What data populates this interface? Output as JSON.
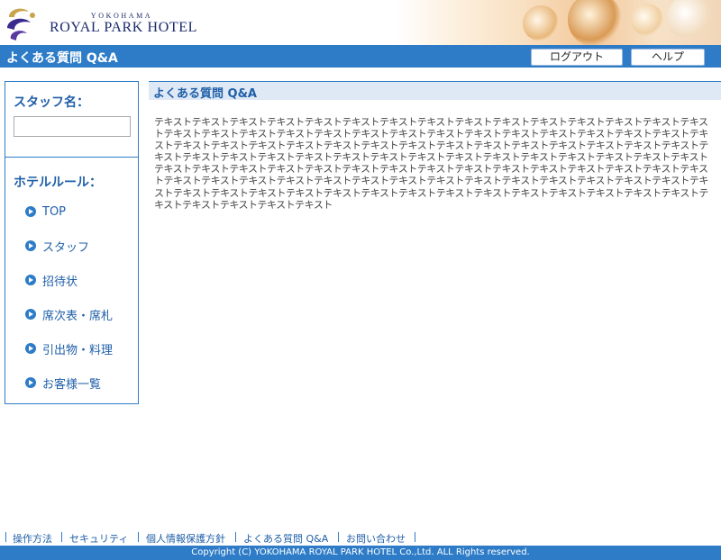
{
  "header": {
    "brand_small": "YOKOHAMA",
    "brand_big": "ROYAL PARK HOTEL"
  },
  "titlebar": {
    "title": "よくある質問 Q&A",
    "logout_label": "ログアウト",
    "help_label": "ヘルプ"
  },
  "sidebar": {
    "staff_label": "スタッフ名：",
    "staff_value": "",
    "rules_label": "ホテルルール：",
    "items": [
      {
        "label": "TOP"
      },
      {
        "label": "スタッフ"
      },
      {
        "label": "招待状"
      },
      {
        "label": "席次表・席札"
      },
      {
        "label": "引出物・料理"
      },
      {
        "label": "お客様一覧"
      }
    ]
  },
  "main": {
    "heading": "よくある質問 Q&A",
    "body": "テキストテキストテキストテキストテキストテキストテキストテキストテキストテキストテキストテキストテキストテキストテキストテキストテキストテキストテキストテキストテキストテキストテキストテキストテキストテキストテキストテキストテキストテキストテキストテキストテキストテキストテキストテキストテキストテキストテキストテキストテキストテキストテキストテキストテキストテキストテキストテキストテキストテキストテキストテキストテキストテキストテキストテキストテキストテキストテキストテキストテキストテキストテキストテキストテキストテキストテキストテキストテキストテキストテキストテキストテキストテキストテキストテキストテキストテキストテキストテキストテキストテキストテキストテキストテキストテキストテキストテキストテキストテキストテキストテキストテキストテキストテキストテキストテキストテキストテキストテキストテキストテキストテキストテキストテキストテキストテキストテキスト"
  },
  "footer": {
    "links": [
      "操作方法",
      "セキュリティ",
      "個人情報保護方針",
      "よくある質問 Q&A",
      "お問い合わせ"
    ],
    "copyright": "Copyright (C) YOKOHAMA ROYAL PARK HOTEL Co.,Ltd. ALL Rights reserved."
  },
  "colors": {
    "accent": "#2e7cc7",
    "link": "#1f5fa8",
    "navy": "#1b2a6b"
  }
}
